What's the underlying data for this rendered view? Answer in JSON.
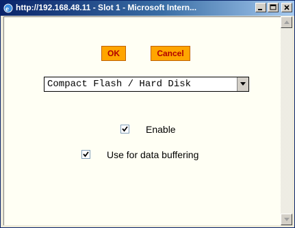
{
  "window": {
    "title": "http://192.168.48.11 - Slot 1 - Microsoft Intern...",
    "controls": {
      "minimize": "minimize-icon",
      "maximize": "maximize-icon",
      "close": "close-icon"
    }
  },
  "form": {
    "ok_label": "OK",
    "cancel_label": "Cancel",
    "device_select": {
      "selected": "Compact Flash / Hard Disk"
    },
    "enable": {
      "label": "Enable",
      "checked": true
    },
    "buffering": {
      "label": "Use for data buffering",
      "checked": true
    }
  },
  "colors": {
    "button_bg": "#ffa500",
    "button_text": "#b00000",
    "client_bg": "#fffff4",
    "titlebar": "#0a246a"
  }
}
